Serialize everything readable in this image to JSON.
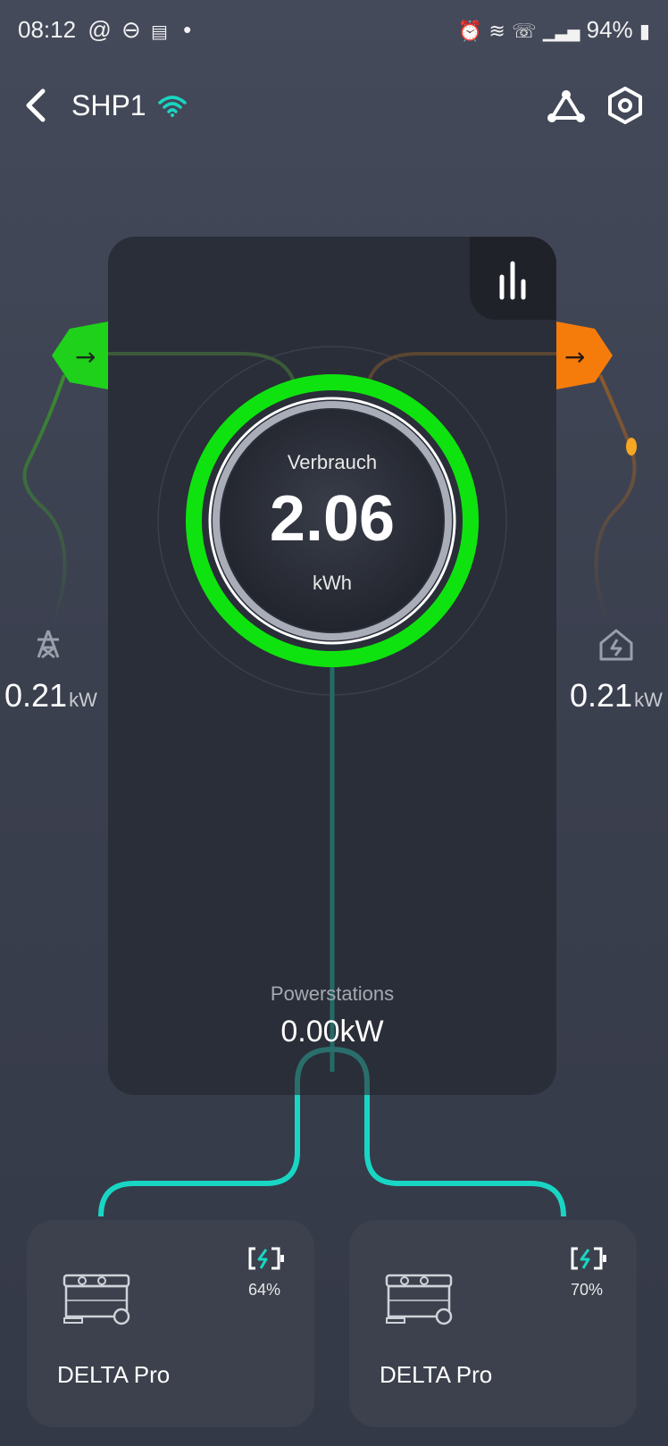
{
  "status_bar": {
    "time": "08:12",
    "battery": "94%"
  },
  "header": {
    "title": "SHP1"
  },
  "center": {
    "label": "Verbrauch",
    "value": "2.06",
    "unit": "kWh"
  },
  "grid": {
    "value": "0.21",
    "unit": "kW"
  },
  "home": {
    "value": "0.21",
    "unit": "kW"
  },
  "powerstations": {
    "label": "Powerstations",
    "value": "0.00kW"
  },
  "devices": [
    {
      "name": "DELTA Pro",
      "battery": "64%"
    },
    {
      "name": "DELTA Pro",
      "battery": "70%"
    }
  ],
  "colors": {
    "grid_green": "#1fd11a",
    "home_orange": "#f57c0b",
    "ring_green": "#0fe30f",
    "line_teal": "#19d6c4",
    "accent_wifi": "#19d6c4"
  }
}
